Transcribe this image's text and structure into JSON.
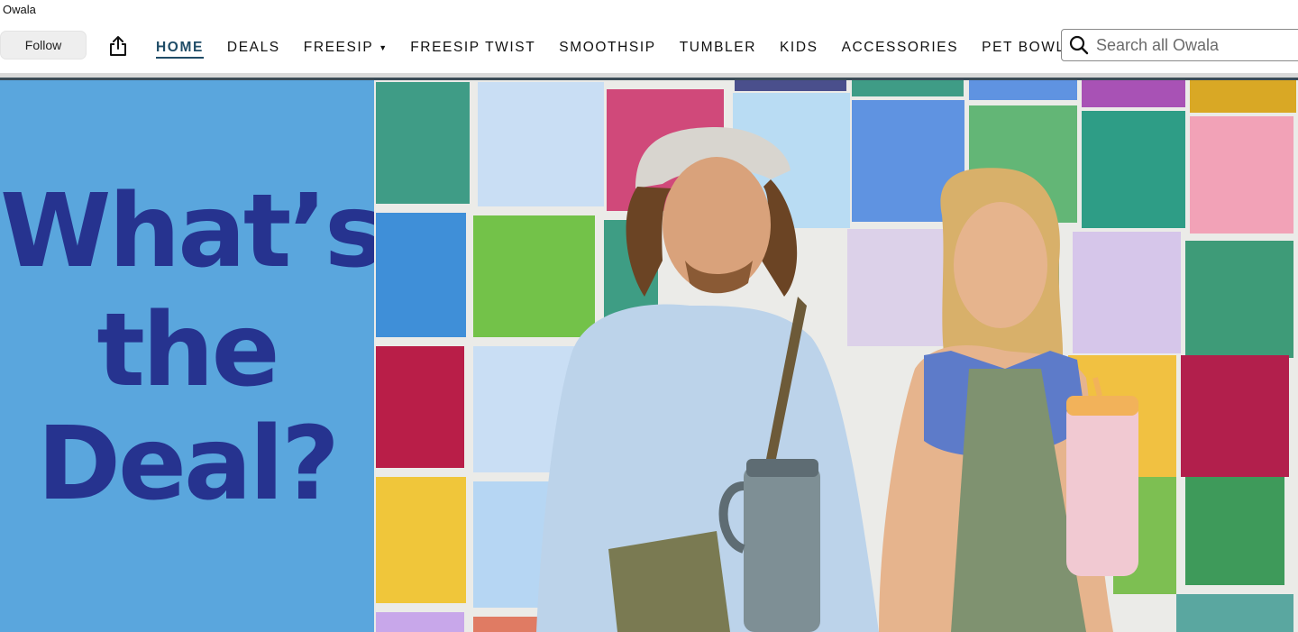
{
  "store": {
    "name": "Owala"
  },
  "follow_label": "Follow",
  "share_icon": "share-icon",
  "nav": {
    "items": [
      {
        "label": "HOME",
        "active": true
      },
      {
        "label": "DEALS"
      },
      {
        "label": "FREESIP",
        "has_dropdown": true
      },
      {
        "label": "FREESIP TWIST"
      },
      {
        "label": "SMOOTHSIP"
      },
      {
        "label": "TUMBLER"
      },
      {
        "label": "KIDS"
      },
      {
        "label": "ACCESSORIES"
      },
      {
        "label": "PET BOWLS"
      }
    ]
  },
  "search": {
    "placeholder": "Search all Owala",
    "icon": "search-icon"
  },
  "hero": {
    "line1": "What’s",
    "line2": "the",
    "line3": "Deal?",
    "panel_color": "#5aa6dd",
    "text_color": "#26338f"
  },
  "colors": {
    "nav_active": "#1f4c67"
  }
}
